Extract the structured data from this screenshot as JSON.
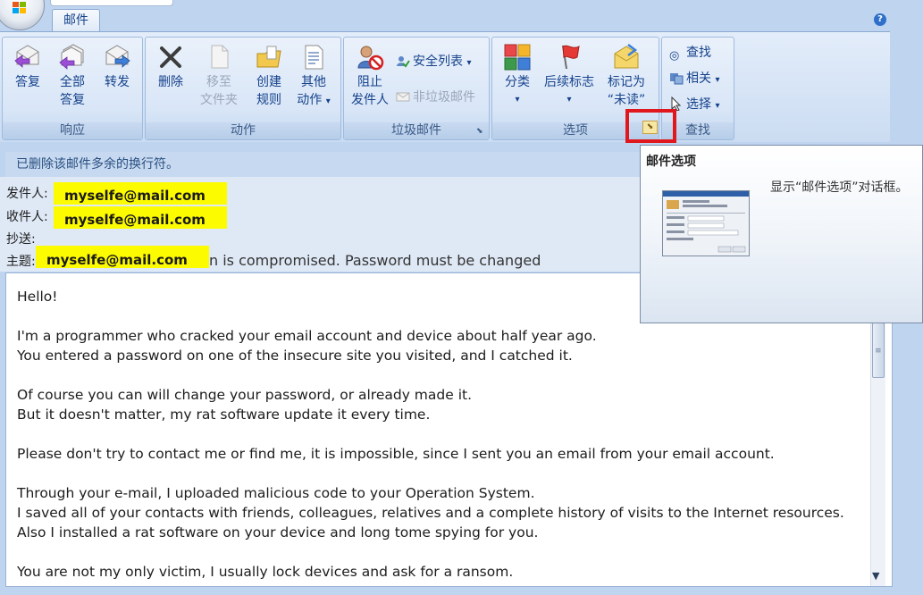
{
  "tabs": {
    "mail": "邮件"
  },
  "help": "?",
  "groups": {
    "respond": {
      "label": "响应",
      "reply": [
        "答复"
      ],
      "reply_all": [
        "全部",
        "答复"
      ],
      "forward": [
        "转发"
      ]
    },
    "actions": {
      "label": "动作",
      "delete": [
        "删除"
      ],
      "move": [
        "移至",
        "文件夹"
      ],
      "create_rule": [
        "创建",
        "规则"
      ],
      "other_actions": [
        "其他",
        "动作"
      ]
    },
    "junk": {
      "label": "垃圾邮件",
      "block_sender": [
        "阻止",
        "发件人"
      ],
      "safe_lists": "安全列表",
      "not_junk": "非垃圾邮件"
    },
    "options": {
      "label": "选项",
      "categorize": "分类",
      "follow_up": "后续标志",
      "mark_unread": [
        "标记为",
        "“未读”"
      ]
    },
    "find": {
      "label": "查找",
      "find": "查找",
      "related": "相关",
      "select": "选择"
    }
  },
  "dropdown_glyph": "▾",
  "launcher_glyph": "⬊",
  "info_bar": "已删除该邮件多余的换行符。",
  "header": {
    "from_label": "发件人:",
    "from_value": "myselfe@mail.com",
    "to_label": "收件人:",
    "to_value": "myselfe@mail.com",
    "cc_label": "抄送:",
    "subject_label": "主题:",
    "subject_value": "myselfe@mail.com",
    "subject_rest": "n is compromised. Password must be changed"
  },
  "body_lines": [
    "Hello!",
    "I'm a programmer who cracked your email account and device about half year ago.",
    "You entered a password on one of the insecure site you visited, and I catched it.",
    "Of course you can will change your password, or already made it.",
    "But it doesn't matter, my rat software update it every time.",
    "Please don't try to contact me or find me, it is impossible, since I sent you an email from your email account.",
    "Through your e-mail, I uploaded malicious code to your Operation System.",
    "I saved all of your contacts with friends, colleagues, relatives and a complete history of visits to the Internet resources.",
    "Also I installed a rat software on your device and long tome spying for you.",
    "You are not my only victim, I usually lock devices and ask for a ransom."
  ],
  "tooltip": {
    "title": "邮件选项",
    "description": "显示“邮件选项”对话框。"
  },
  "colors": {
    "highlight_yellow": "#fdfb00",
    "annotation_red": "#e0181d",
    "ribbon_text": "#15428b"
  }
}
